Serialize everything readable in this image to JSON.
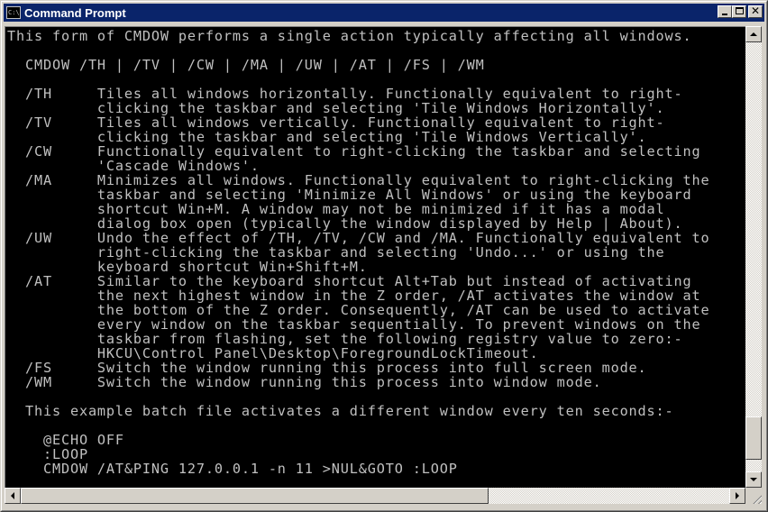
{
  "window": {
    "title": "Command Prompt",
    "app_icon": "command-prompt-icon",
    "app_icon_text": "C:\\.",
    "controls": {
      "minimize": "minimize-icon",
      "maximize": "maximize-icon",
      "close": "close-icon"
    }
  },
  "console": {
    "text_color": "#c0c0c0",
    "background_color": "#000000",
    "lines": [
      "This form of CMDOW performs a single action typically affecting all windows.",
      "",
      "  CMDOW /TH | /TV | /CW | /MA | /UW | /AT | /FS | /WM",
      "",
      "  /TH     Tiles all windows horizontally. Functionally equivalent to right-",
      "          clicking the taskbar and selecting 'Tile Windows Horizontally'.",
      "  /TV     Tiles all windows vertically. Functionally equivalent to right-",
      "          clicking the taskbar and selecting 'Tile Windows Vertically'.",
      "  /CW     Functionally equivalent to right-clicking the taskbar and selecting",
      "          'Cascade Windows'.",
      "  /MA     Minimizes all windows. Functionally equivalent to right-clicking the",
      "          taskbar and selecting 'Minimize All Windows' or using the keyboard",
      "          shortcut Win+M. A window may not be minimized if it has a modal",
      "          dialog box open (typically the window displayed by Help | About).",
      "  /UW     Undo the effect of /TH, /TV, /CW and /MA. Functionally equivalent to",
      "          right-clicking the taskbar and selecting 'Undo...' or using the",
      "          keyboard shortcut Win+Shift+M.",
      "  /AT     Similar to the keyboard shortcut Alt+Tab but instead of activating",
      "          the next highest window in the Z order, /AT activates the window at",
      "          the bottom of the Z order. Consequently, /AT can be used to activate",
      "          every window on the taskbar sequentially. To prevent windows on the",
      "          taskbar from flashing, set the following registry value to zero:-",
      "          HKCU\\Control Panel\\Desktop\\ForegroundLockTimeout.",
      "  /FS     Switch the window running this process into full screen mode.",
      "  /WM     Switch the window running this process into window mode.",
      "",
      "  This example batch file activates a different window every ten seconds:-",
      "",
      "    @ECHO OFF",
      "    :LOOP",
      "    CMDOW /AT&PING 127.0.0.1 -n 11 >NUL&GOTO :LOOP"
    ]
  },
  "scrollbars": {
    "vertical": {
      "position_fraction": 0.97,
      "visible_fraction": 0.1
    },
    "horizontal": {
      "position_fraction": 0.0,
      "visible_fraction": 0.66
    }
  }
}
